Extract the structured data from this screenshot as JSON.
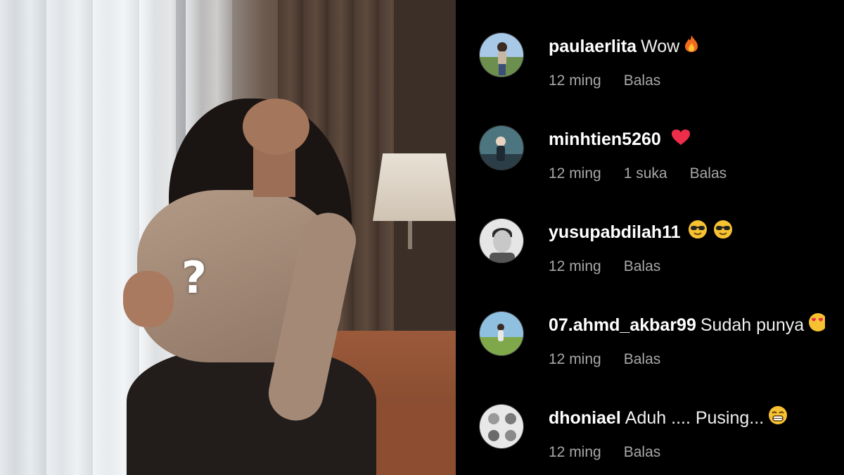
{
  "photo": {
    "overlay_mark": "?"
  },
  "comments": [
    {
      "username": "paulaerlita",
      "text": "Wow",
      "emoji": "fire-icon",
      "time": "12 ming",
      "likes": "",
      "reply_label": "Balas",
      "avatar_colors": [
        "#6d8f4e",
        "#c9b6a3"
      ]
    },
    {
      "username": "minhtien5260",
      "text": "",
      "emoji": "heart-icon",
      "time": "12 ming",
      "likes": "1 suka",
      "reply_label": "Balas",
      "avatar_colors": [
        "#4d7580",
        "#2b3d46"
      ]
    },
    {
      "username": "yusupabdilah11",
      "text": "",
      "emoji": "sunglasses-face-icon",
      "emoji_count": 2,
      "time": "12 ming",
      "likes": "",
      "reply_label": "Balas",
      "avatar_colors": [
        "#dddddd",
        "#2a2a2a"
      ]
    },
    {
      "username": "07.ahmd_akbar99",
      "text": "Sudah punya",
      "emoji": "heart-eyes-face-icon",
      "time": "12 ming",
      "likes": "",
      "reply_label": "Balas",
      "avatar_colors": [
        "#8fc0e0",
        "#7fa84a"
      ]
    },
    {
      "username": "dhoniael",
      "text": "Aduh .... Pusing...",
      "emoji": "grinning-face-icon",
      "time": "12 ming",
      "likes": "",
      "reply_label": "Balas",
      "avatar_colors": [
        "#e8e8e8",
        "#6a6a6a"
      ]
    }
  ],
  "colors": {
    "background": "#000000",
    "username": "#ffffff",
    "meta": "#a8a8a8",
    "heart": "#ed2e4a",
    "emoji_yellow": "#f6c232"
  }
}
